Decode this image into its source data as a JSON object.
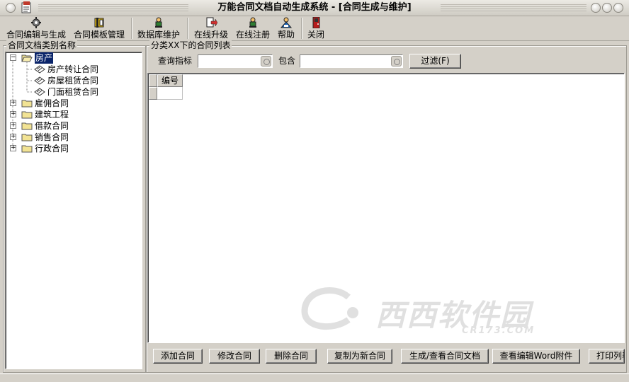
{
  "window": {
    "title": "万能合同文档自动生成系统 - [合同生成与维护]"
  },
  "toolbar": {
    "items": [
      {
        "label": "合同编辑与生成",
        "icon": "gear-icon"
      },
      {
        "label": "合同模板管理",
        "icon": "template-icon"
      },
      {
        "label": "数据库维护",
        "icon": "person-icon"
      },
      {
        "label": "在线升级",
        "icon": "upgrade-icon"
      },
      {
        "label": "在线注册",
        "icon": "register-person-icon"
      },
      {
        "label": "帮助",
        "icon": "help-icon"
      },
      {
        "label": "关闭",
        "icon": "close-door-icon"
      }
    ]
  },
  "left_panel": {
    "title": "合同文档类别名称",
    "tree": [
      {
        "label": "房产",
        "expanded": true,
        "selected": true,
        "children": [
          "房产转让合同",
          "房屋租赁合同",
          "门面租赁合同"
        ]
      },
      {
        "label": "雇佣合同",
        "expanded": false
      },
      {
        "label": "建筑工程",
        "expanded": false
      },
      {
        "label": "借款合同",
        "expanded": false
      },
      {
        "label": "销售合同",
        "expanded": false
      },
      {
        "label": "行政合同",
        "expanded": false
      }
    ]
  },
  "right_panel": {
    "title": "分类XX下的合同列表",
    "filter": {
      "query_label": "查询指标",
      "query_value": "",
      "contains_label": "包含",
      "contains_value": "",
      "filter_button": "过滤(F)"
    },
    "grid": {
      "columns": [
        "编号"
      ]
    },
    "buttons": [
      "添加合同",
      "修改合同",
      "删除合同",
      "复制为新合同",
      "生成/查看合同文档",
      "查看编辑Word附件",
      "打印列表"
    ]
  },
  "watermark": {
    "text": "西西软件园",
    "subtext": "CR173.COM"
  },
  "colors": {
    "face": "#d4d0c8",
    "selection": "#0a246a"
  }
}
